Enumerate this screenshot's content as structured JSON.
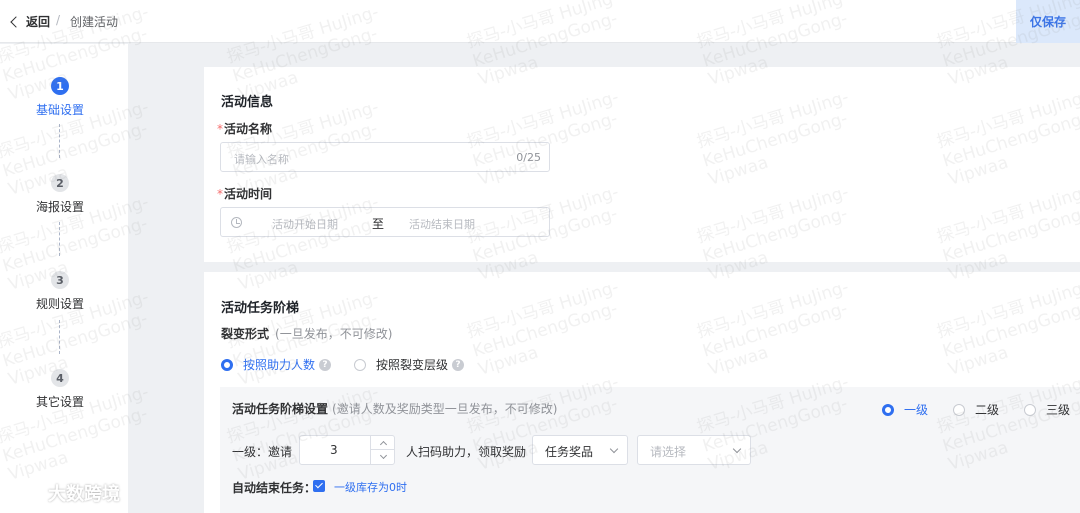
{
  "header": {
    "back_label": "返回",
    "separator": "/",
    "title": "创建活动",
    "save_label": "仅保存"
  },
  "steps": [
    {
      "num": "1",
      "label": "基础设置",
      "active": true
    },
    {
      "num": "2",
      "label": "海报设置",
      "active": false
    },
    {
      "num": "3",
      "label": "规则设置",
      "active": false
    },
    {
      "num": "4",
      "label": "其它设置",
      "active": false
    }
  ],
  "activity_info": {
    "section_title": "活动信息",
    "required_mark": "*",
    "name_label": "活动名称",
    "name_placeholder": "请输入名称",
    "name_count": "0/25",
    "time_label": "活动时间",
    "start_placeholder": "活动开始日期",
    "range_separator": "至",
    "end_placeholder": "活动结束日期"
  },
  "task_ladder": {
    "section_title": "活动任务阶梯",
    "mode_label": "裂变形式",
    "mode_note": "(一旦发布，不可修改)",
    "mode_options": [
      {
        "label": "按照助力人数",
        "selected": true,
        "help": "?"
      },
      {
        "label": "按照裂变层级",
        "selected": false,
        "help": "?"
      }
    ],
    "settings_title": "活动任务阶梯设置",
    "settings_note": "(邀请人数及奖励类型一旦发布，不可修改)",
    "levels": [
      {
        "label": "一级",
        "selected": true
      },
      {
        "label": "二级",
        "selected": false
      },
      {
        "label": "三级",
        "selected": false
      }
    ],
    "level1_label": "一级：邀请",
    "invite_count": "3",
    "scan_text": "人扫码助力，领取奖励",
    "reward_type": "任务奖品",
    "reward_placeholder": "请选择",
    "auto_end_label": "自动结束任务：",
    "auto_end_checked": true,
    "auto_end_option": "一级库存为0时"
  },
  "watermark": {
    "line1": "探马-小马哥 HuJing-",
    "line2": "KeHuChengGong-",
    "line3": "Vipwaa"
  },
  "logo": {
    "text": "大数跨境"
  }
}
